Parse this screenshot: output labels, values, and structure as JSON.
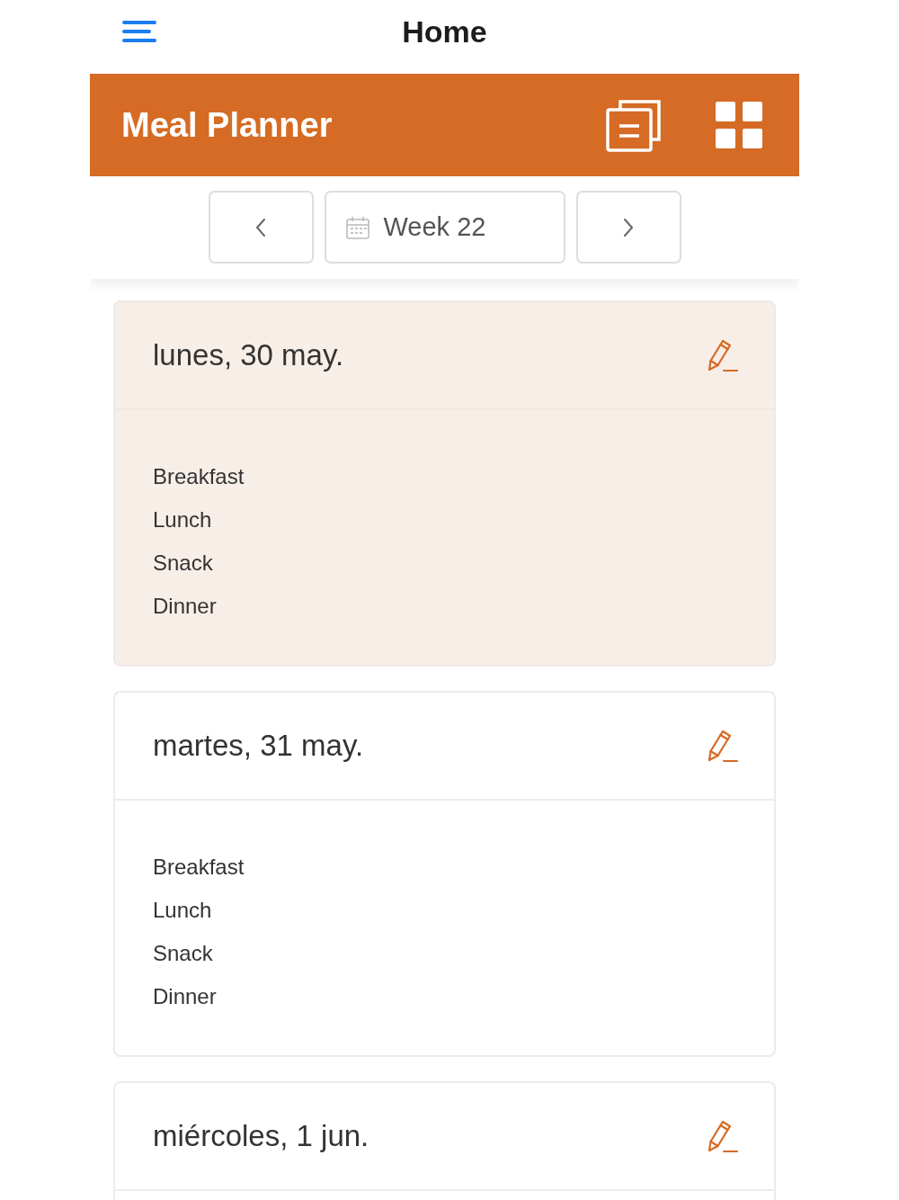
{
  "top_bar": {
    "title": "Home"
  },
  "header": {
    "title": "Meal Planner"
  },
  "week_nav": {
    "label": "Week 22"
  },
  "days": [
    {
      "date": "lunes, 30 may.",
      "today": true,
      "meals": [
        "Breakfast",
        "Lunch",
        "Snack",
        "Dinner"
      ]
    },
    {
      "date": "martes, 31 may.",
      "today": false,
      "meals": [
        "Breakfast",
        "Lunch",
        "Snack",
        "Dinner"
      ]
    },
    {
      "date": "miércoles, 1 jun.",
      "today": false
    }
  ]
}
